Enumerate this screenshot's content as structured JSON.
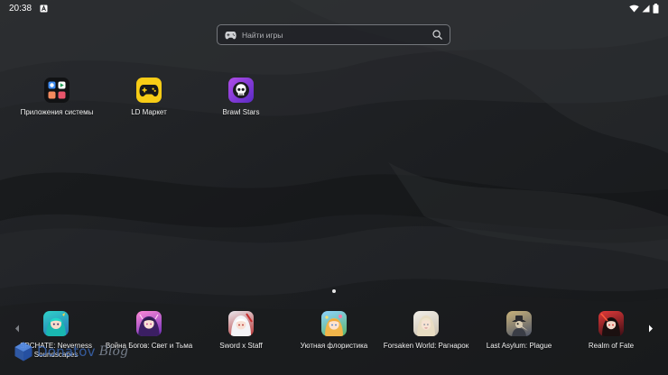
{
  "status_bar": {
    "time": "20:38"
  },
  "search": {
    "placeholder": "Найти игры"
  },
  "desktop_apps": [
    {
      "label": "Приложения системы",
      "icon": "system-apps-folder-icon"
    },
    {
      "label": "LD Маркет",
      "icon": "ld-market-gamepad-icon"
    },
    {
      "label": "Brawl Stars",
      "icon": "brawl-stars-skull-icon"
    }
  ],
  "dock_apps": [
    {
      "label": "SPCHATE: Neverness Soundscapes",
      "icon": "game-anime-girl-teal-icon"
    },
    {
      "label": "Война Богов: Свет и Тьма",
      "icon": "game-anime-girl-purple-icon"
    },
    {
      "label": "Sword x Staff",
      "icon": "game-white-hair-girl-icon"
    },
    {
      "label": "Уютная флористика",
      "icon": "game-flower-girl-icon"
    },
    {
      "label": "Forsaken World: Рагнарок",
      "icon": "game-elf-portrait-icon"
    },
    {
      "label": "Last Asylum: Plague",
      "icon": "game-plague-doctor-icon"
    },
    {
      "label": "Realm of Fate",
      "icon": "game-red-warrior-icon"
    }
  ],
  "watermark": {
    "brand": "Donatov",
    "suffix": "Blog"
  },
  "colors": {
    "background": "#1d1f22",
    "ld_market_yellow": "#f7cc16",
    "brawl_purple": "#7a33d6",
    "search_border": "#74777c"
  }
}
